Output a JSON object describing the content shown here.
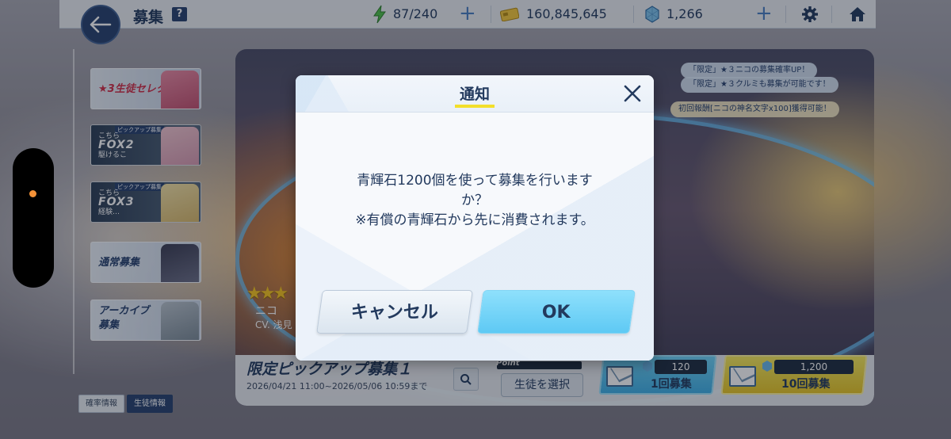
{
  "header": {
    "title": "募集",
    "help_badge": "?",
    "ap": "87/240",
    "credits": "160,845,645",
    "gems": "1,266"
  },
  "sidebar": {
    "items": [
      {
        "label": "★3生徒セレクト"
      },
      {
        "tag": "ピックアップ募集",
        "fox_small": "こちら",
        "fox_big": "FOX2",
        "fox_sub": "駆けるこ"
      },
      {
        "tag": "ピックアップ募集",
        "fox_small": "こちら",
        "fox_big": "FOX3",
        "fox_sub": "経験…"
      },
      {
        "label": "通常募集"
      },
      {
        "label": "アーカイブ\n募集"
      }
    ],
    "info_buttons": [
      "確率情報",
      "生徒情報"
    ]
  },
  "banner": {
    "info_tags": [
      "「限定」★３ニコの募集確率UP！",
      "「限定」★３クルミも募集が可能です！",
      "初回報酬[ニコの神名文字x100]獲得可能！"
    ],
    "stars": "★★★",
    "character_name": "ニコ",
    "cv": "CV. 浅見",
    "title": "限定ピックアップ募集１",
    "period": "2026/04/21 11:00~2026/05/06 10:59まで",
    "point_label": "Point",
    "select_student": "生徒を選択",
    "single": {
      "cost": "120",
      "label": "1回募集"
    },
    "ten": {
      "cost": "1,200",
      "label": "10回募集",
      "badge": "10"
    }
  },
  "dialog": {
    "title": "通知",
    "message_line1": "青輝石1200個を使って募集を行います",
    "message_line2": "か？",
    "message_line3": "※有償の青輝石から先に消費されます。",
    "cancel_label": "キャンセル",
    "ok_label": "OK"
  },
  "colors": {
    "navy": "#233a5e",
    "accent_blue": "#5ec9f4",
    "accent_yellow": "#f3df2a",
    "star": "#f7c51f"
  },
  "icons": [
    "back-arrow-icon",
    "lightning-icon",
    "credit-card-icon",
    "gem-icon",
    "plus-icon",
    "gear-icon",
    "home-icon",
    "search-icon",
    "close-icon",
    "envelope-icon"
  ]
}
